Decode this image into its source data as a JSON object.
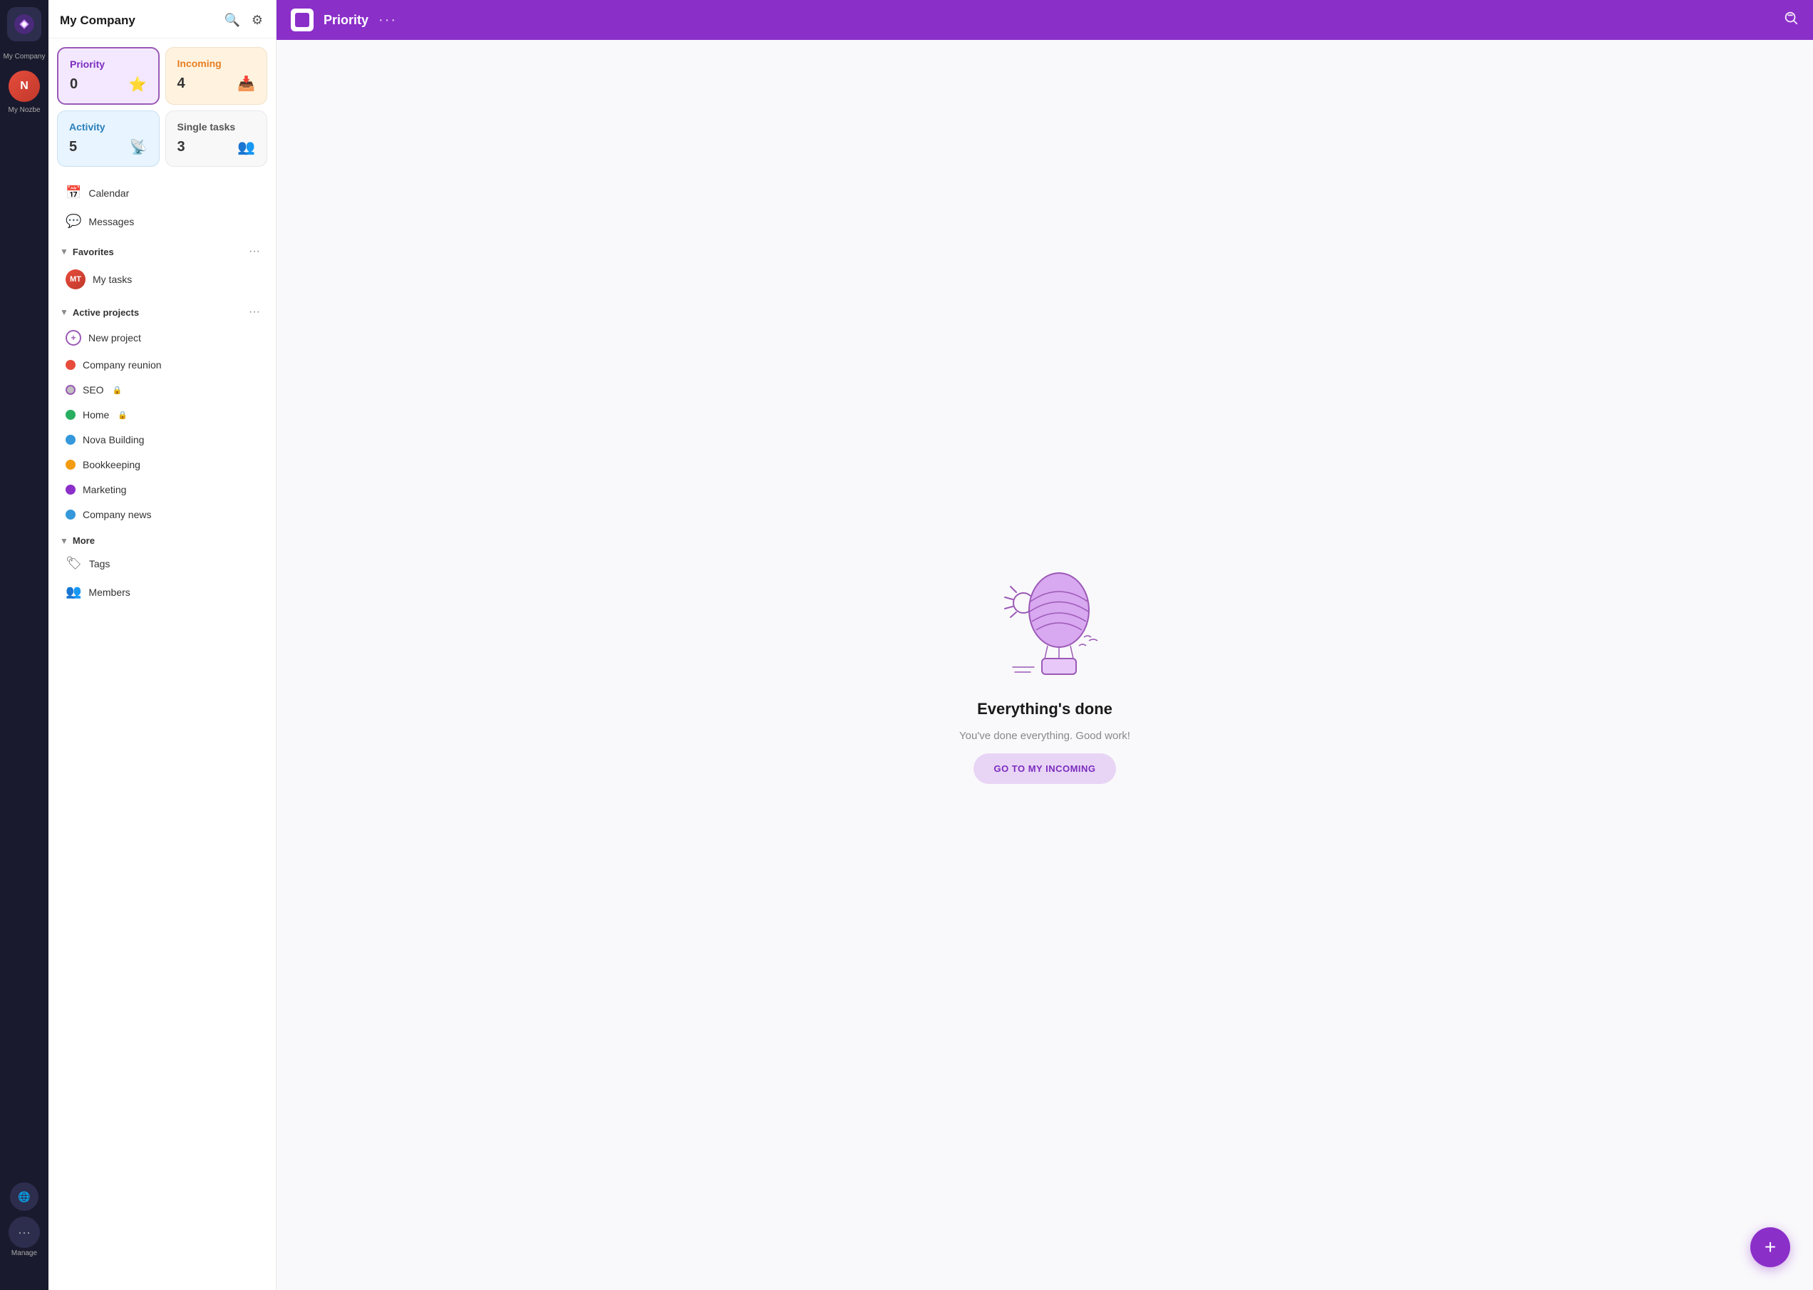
{
  "app": {
    "company_name": "My Company",
    "logo_label": "My Company"
  },
  "sidebar": {
    "search_icon": "🔍",
    "settings_icon": "⚙",
    "my_nozbe_label": "My Nozbe",
    "manage_label": "Manage",
    "tiles": [
      {
        "id": "priority",
        "label": "Priority",
        "count": "0",
        "icon": "⭐",
        "style": "priority"
      },
      {
        "id": "incoming",
        "label": "Incoming",
        "count": "4",
        "icon": "📥",
        "style": "incoming"
      },
      {
        "id": "activity",
        "label": "Activity",
        "count": "5",
        "icon": "📡",
        "style": "activity"
      },
      {
        "id": "single-tasks",
        "label": "Single tasks",
        "count": "3",
        "icon": "👥",
        "style": "single"
      }
    ],
    "nav_items": [
      {
        "id": "calendar",
        "icon": "📅",
        "label": "Calendar"
      },
      {
        "id": "messages",
        "icon": "💬",
        "label": "Messages"
      }
    ],
    "favorites": {
      "label": "Favorites",
      "items": [
        {
          "id": "my-tasks",
          "label": "My tasks",
          "avatar": "MT"
        }
      ]
    },
    "active_projects": {
      "label": "Active projects",
      "items": [
        {
          "id": "new-project",
          "label": "New project",
          "color": null,
          "type": "add"
        },
        {
          "id": "company-reunion",
          "label": "Company reunion",
          "color": "#e74c3c"
        },
        {
          "id": "seo",
          "label": "SEO",
          "color": "#9b59b6",
          "private": true
        },
        {
          "id": "home",
          "label": "Home",
          "color": "#27ae60",
          "lock": true
        },
        {
          "id": "nova-building",
          "label": "Nova Building",
          "color": "#3498db"
        },
        {
          "id": "bookkeeping",
          "label": "Bookkeeping",
          "color": "#f39c12"
        },
        {
          "id": "marketing",
          "label": "Marketing",
          "color": "#8b2fc9"
        },
        {
          "id": "company-news",
          "label": "Company news",
          "color": "#3498db"
        }
      ]
    },
    "more": {
      "label": "More",
      "items": [
        {
          "id": "tags",
          "label": "Tags",
          "icon": "🏷"
        },
        {
          "id": "members",
          "label": "Members",
          "icon": "👥"
        }
      ]
    }
  },
  "topbar": {
    "title": "Priority",
    "dots": "···",
    "search_icon": "🔍"
  },
  "main": {
    "empty_title": "Everything's done",
    "empty_subtitle": "You've done everything. Good work!",
    "goto_button_label": "GO TO MY INCOMING"
  }
}
